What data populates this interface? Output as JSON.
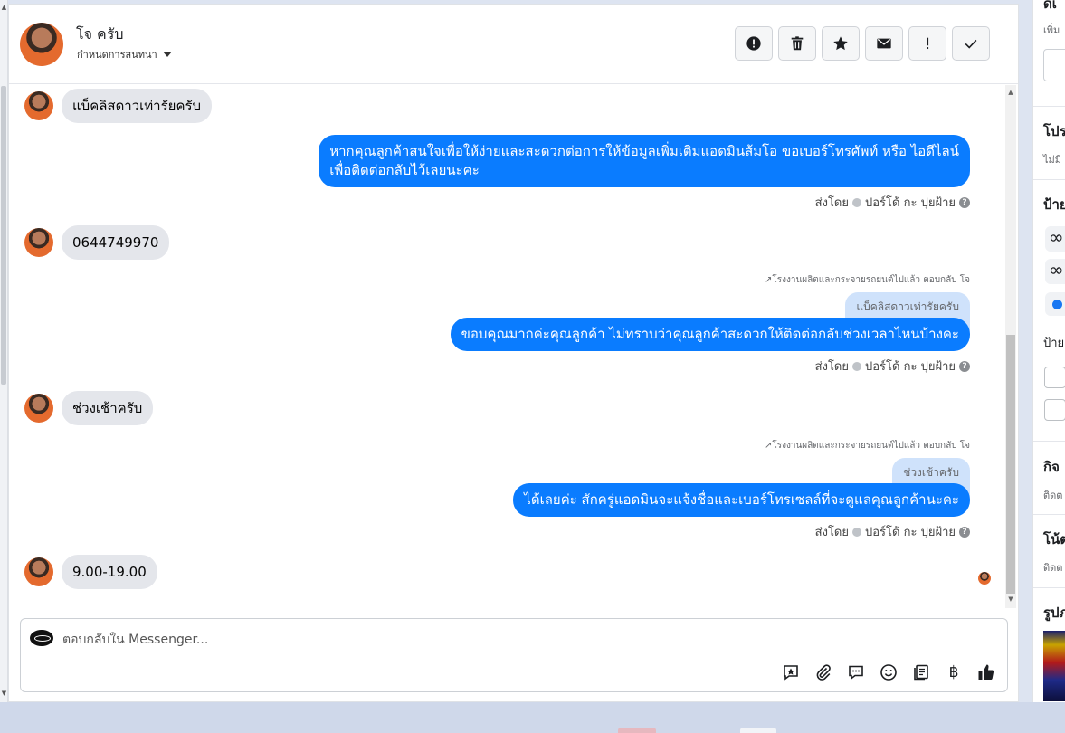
{
  "header": {
    "name": "โจ ครับ",
    "assign_label": "กำหนดการสนทนา",
    "actions": [
      {
        "name": "report-spam-button",
        "icon": "alert-circle-icon"
      },
      {
        "name": "delete-button",
        "icon": "trash-icon"
      },
      {
        "name": "star-button",
        "icon": "star-icon"
      },
      {
        "name": "mark-unread-button",
        "icon": "envelope-icon"
      },
      {
        "name": "follow-up-button",
        "icon": "exclamation-icon"
      },
      {
        "name": "mark-done-button",
        "icon": "checkmark-icon"
      }
    ]
  },
  "messages": {
    "m1": "แบ็คลิสดาวเท่ารัยครับ",
    "m2_line1": "หากคุณลูกค้าสนใจเพื่อให้ง่ายและสะดวกต่อการให้ข้อมูลเพิ่มเติมแอดมินส้มโอ ขอเบอร์โทรศัพท์ หรือ ไอดีไลน์",
    "m2_line2": "เพื่อติดต่อกลับไว้เลยนะคะ",
    "m3": "0644749970",
    "m4_reply_meta": "โรงงานผลิตและกระจายรถยนต์ไปแล้ว ตอบกลับ โจ",
    "m4_quote": "แบ็คลิสดาวเท่ารัยครับ",
    "m4": "ขอบคุณมากค่ะคุณลูกค้า ไม่ทราบว่าคุณลูกค้าสะดวกให้ติดต่อกลับช่วงเวลาไหนบ้างคะ",
    "m5": "ช่วงเช้าครับ",
    "m6_reply_meta": "โรงงานผลิตและกระจายรถยนต์ไปแล้ว ตอบกลับ โจ",
    "m6_quote": "ช่วงเช้าครับ",
    "m6": "ได้เลยค่ะ สักครู่แอดมินจะแจ้งชื่อและเบอร์โทรเซลล์ที่จะดูแลคุณลูกค้านะคะ",
    "m7": "9.00-19.00",
    "sent_by_prefix": "ส่งโดย",
    "sent_by_name": "ปอร์โด้ กะ ปุยฝ้าย"
  },
  "composer": {
    "placeholder": "ตอบกลับใน Messenger...",
    "tools": [
      "saved-reply-icon",
      "attachment-icon",
      "chat-bubble-icon",
      "emoji-icon",
      "catalog-icon",
      "baht-icon",
      "thumbs-up-icon"
    ],
    "baht_symbol": "฿"
  },
  "right_panel": {
    "top_title": "ดีเ",
    "top_sub": "เพิ่ม",
    "profile_title": "โปร",
    "profile_sub": "ไม่มี",
    "labels_title": "ป้าย",
    "tag_glyph": "∞",
    "labels2_title": "ป้าย",
    "activity_title": "กิจ",
    "activity_sub": "ติดต",
    "notes_title": "โน้ต",
    "notes_sub": "ติดต",
    "media_title": "รูปภ"
  },
  "colors": {
    "outgoing_bubble": "#0a7cff",
    "incoming_bubble": "#e4e6eb",
    "quote_bubble": "#cfe2fb"
  }
}
